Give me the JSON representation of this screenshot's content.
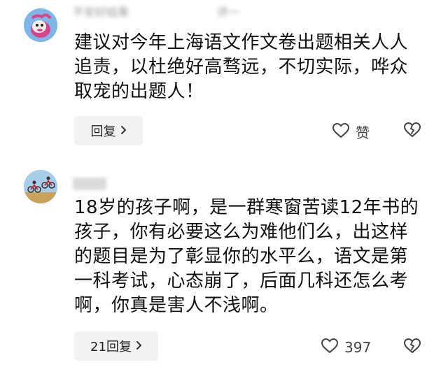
{
  "comments": [
    {
      "username": "不安好结果",
      "timestamp": "评一",
      "text": "建议对今年上海语文作文卷出题相关人人追责，以杜绝好高骛远，不切实际，哗众取宠的出题人！",
      "reply_label": "回复",
      "like_label": "赞"
    },
    {
      "username": "",
      "text": "18岁的孩子啊，是一群寒窗苦读12年书的孩子，你有必要这么为难他们么，出这样的题目是为了彰显你的水平么，语文是第一科考试，心态崩了，后面几科还怎么考啊，你真是害人不浅啊。",
      "reply_label": "21回复",
      "like_label": "397"
    }
  ],
  "icons": {
    "like": "heart-outline-icon",
    "dislike": "broken-heart-icon",
    "chevron": "chevron-right-icon"
  },
  "colors": {
    "avatar1_bg": "#7fb6e8",
    "avatar2_bg": "#a8cde8",
    "reply_bg": "#f2f2f2"
  }
}
